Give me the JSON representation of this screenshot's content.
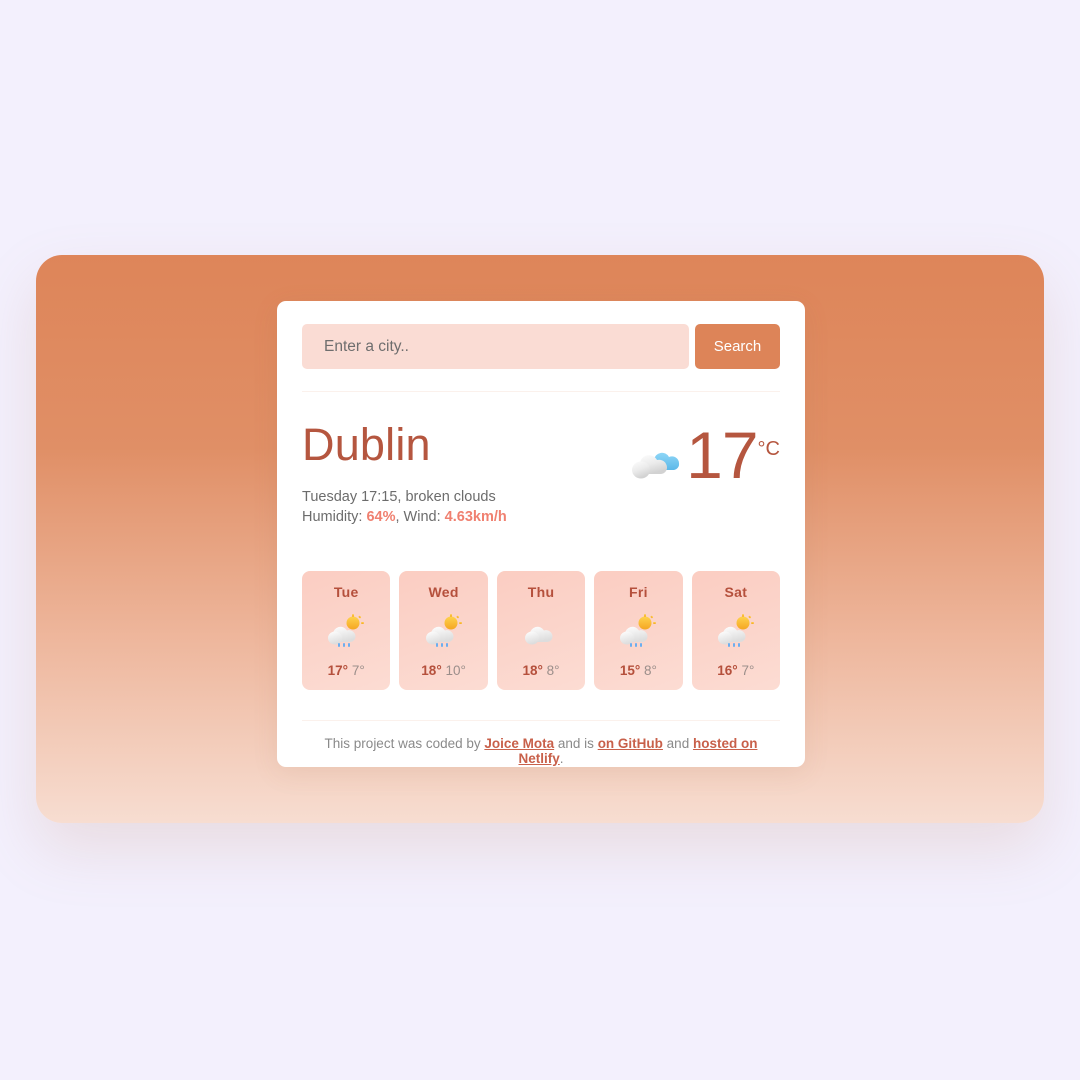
{
  "search": {
    "placeholder": "Enter a city..",
    "value": "",
    "button_label": "Search"
  },
  "current": {
    "city": "Dublin",
    "temperature": "17",
    "unit": "°C",
    "icon": "broken-clouds-icon",
    "datetime_description": "Tuesday 17:15, broken clouds",
    "humidity_label": "Humidity: ",
    "humidity_value": "64%",
    "wind_separator": ", Wind: ",
    "wind_value": "4.63km/h"
  },
  "forecast": [
    {
      "day": "Tue",
      "icon": "sun-cloud-rain-icon",
      "max": "17°",
      "min": "7°"
    },
    {
      "day": "Wed",
      "icon": "sun-cloud-rain-icon",
      "max": "18°",
      "min": "10°"
    },
    {
      "day": "Thu",
      "icon": "cloud-icon",
      "max": "18°",
      "min": "8°"
    },
    {
      "day": "Fri",
      "icon": "sun-cloud-rain-icon",
      "max": "15°",
      "min": "8°"
    },
    {
      "day": "Sat",
      "icon": "sun-cloud-rain-icon",
      "max": "16°",
      "min": "7°"
    }
  ],
  "footer": {
    "prefix": "This project was coded by ",
    "author_link": "Joice Mota",
    "middle": " and is ",
    "github_link": "on GitHub",
    "middle2": " and ",
    "netlify_link": "hosted on Netlify",
    "suffix": "."
  },
  "colors": {
    "page_background": "#f3f0fd",
    "frame_gradient_top": "#de8559",
    "frame_gradient_bottom": "#f7ddd1",
    "card_background": "#ffffff",
    "accent": "#b5563f",
    "button": "#dd8458",
    "input_background": "#fadcd4",
    "metric": "#f08070",
    "forecast_card": "#fbcdc2"
  }
}
